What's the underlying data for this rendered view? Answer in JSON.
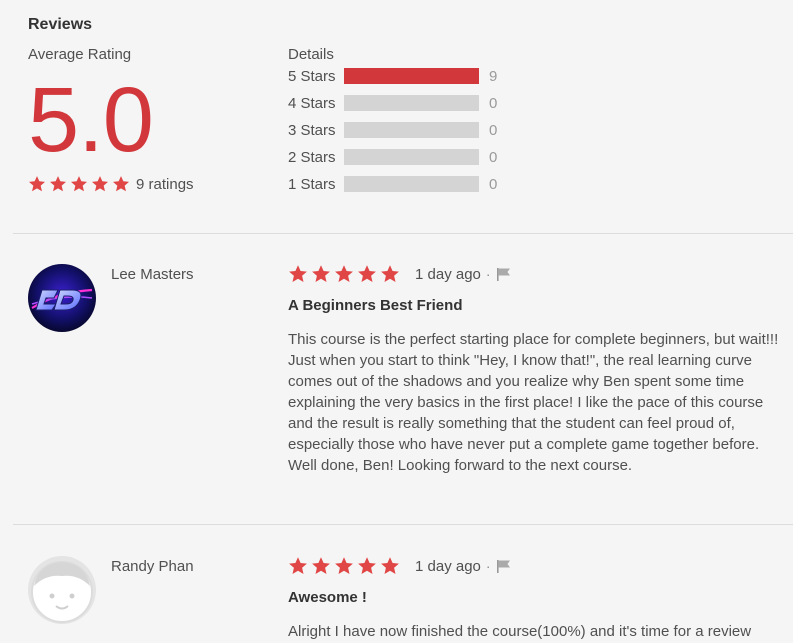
{
  "reviews_heading": "Reviews",
  "summary": {
    "average_label": "Average Rating",
    "average_value": "5.0",
    "stars": 5,
    "ratings_text": "9 ratings",
    "details_label": "Details",
    "breakdown": [
      {
        "label": "5 Stars",
        "count": "9",
        "fraction": 1.0
      },
      {
        "label": "4 Stars",
        "count": "0",
        "fraction": 0
      },
      {
        "label": "3 Stars",
        "count": "0",
        "fraction": 0
      },
      {
        "label": "2 Stars",
        "count": "0",
        "fraction": 0
      },
      {
        "label": "1 Stars",
        "count": "0",
        "fraction": 0
      }
    ]
  },
  "reviews": [
    {
      "name": "Lee Masters",
      "stars": 5,
      "date": "1 day ago",
      "title": "A Beginners Best Friend",
      "body": "This course is the perfect starting place for complete beginners, but wait!!! Just when you start to think \"Hey, I know that!\", the real learning curve comes out of the shadows and you realize why Ben spent some time explaining the very basics in the first place! I like the pace of this course and the result is really something that the student can feel proud of, especially those who have never put a complete game together before. Well done, Ben! Looking forward to the next course.",
      "avatar": "logo-avatar"
    },
    {
      "name": "Randy Phan",
      "stars": 5,
      "date": "1 day ago",
      "title": "Awesome !",
      "body": "Alright I have now finished the course(100%) and it's time for a review",
      "avatar": "default-face-avatar"
    }
  ],
  "colors": {
    "accent": "#d2383b",
    "star": "#e04646",
    "bar_empty": "#d4d4d4",
    "background": "#f5f5f5"
  }
}
